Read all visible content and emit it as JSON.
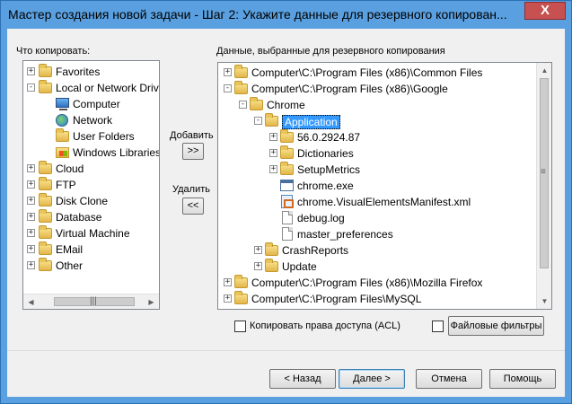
{
  "window": {
    "title": "Мастер создания новой задачи - Шаг 2: Укажите данные для резервного копирован...",
    "close_label": "X"
  },
  "left_panel": {
    "label": "Что копировать:",
    "items": [
      {
        "label": "Favorites",
        "icon": "folder-icon",
        "expander": "+"
      },
      {
        "label": "Local or Network Drive",
        "icon": "folder-icon",
        "expander": "-"
      },
      {
        "label": "Computer",
        "icon": "computer-icon",
        "expander": ""
      },
      {
        "label": "Network",
        "icon": "network-icon",
        "expander": ""
      },
      {
        "label": "User Folders",
        "icon": "folder-icon",
        "expander": ""
      },
      {
        "label": "Windows Libraries",
        "icon": "windows-libraries-icon",
        "expander": ""
      },
      {
        "label": "Cloud",
        "icon": "folder-icon",
        "expander": "+"
      },
      {
        "label": "FTP",
        "icon": "folder-icon",
        "expander": "+"
      },
      {
        "label": "Disk Clone",
        "icon": "folder-icon",
        "expander": "+"
      },
      {
        "label": "Database",
        "icon": "folder-icon",
        "expander": "+"
      },
      {
        "label": "Virtual Machine",
        "icon": "folder-icon",
        "expander": "+"
      },
      {
        "label": "EMail",
        "icon": "folder-icon",
        "expander": "+"
      },
      {
        "label": "Other",
        "icon": "folder-icon",
        "expander": "+"
      }
    ],
    "hscroll_left": "◀",
    "hscroll_right": "▶",
    "hscroll_grip": "|||"
  },
  "middle": {
    "add_label": "Добавить",
    "add_button": ">>",
    "remove_label": "Удалить",
    "remove_button": "<<"
  },
  "right_panel": {
    "label": "Данные, выбранные для резервного копирования",
    "items": [
      {
        "label": "Computer\\C:\\Program Files (x86)\\Common Files",
        "icon": "folder-icon",
        "expander": "+"
      },
      {
        "label": "Computer\\C:\\Program Files (x86)\\Google",
        "icon": "folder-icon",
        "expander": "-"
      },
      {
        "label": "Chrome",
        "icon": "folder-icon",
        "expander": "-"
      },
      {
        "label": "Application",
        "icon": "folder-icon",
        "expander": "-",
        "selected": true
      },
      {
        "label": "56.0.2924.87",
        "icon": "folder-icon",
        "expander": "+"
      },
      {
        "label": "Dictionaries",
        "icon": "folder-icon",
        "expander": "+"
      },
      {
        "label": "SetupMetrics",
        "icon": "folder-icon",
        "expander": "+"
      },
      {
        "label": "chrome.exe",
        "icon": "exe-file-icon",
        "expander": ""
      },
      {
        "label": "chrome.VisualElementsManifest.xml",
        "icon": "xml-file-icon",
        "expander": ""
      },
      {
        "label": "debug.log",
        "icon": "file-icon",
        "expander": ""
      },
      {
        "label": "master_preferences",
        "icon": "file-icon",
        "expander": ""
      },
      {
        "label": "CrashReports",
        "icon": "folder-icon",
        "expander": "+"
      },
      {
        "label": "Update",
        "icon": "folder-icon",
        "expander": "+"
      },
      {
        "label": "Computer\\C:\\Program Files (x86)\\Mozilla Firefox",
        "icon": "folder-icon",
        "expander": "+"
      },
      {
        "label": "Computer\\C:\\Program Files\\MySQL",
        "icon": "folder-icon",
        "expander": "+"
      }
    ],
    "vscroll_up": "▲",
    "vscroll_down": "▼",
    "vscroll_grip": "≡"
  },
  "options": {
    "acl_label": "Копировать права доступа (ACL)",
    "acl_checked": false,
    "filters_checked": false,
    "filters_button": "Файловые фильтры"
  },
  "footer": {
    "back": "< Назад",
    "next": "Далее >",
    "cancel": "Отмена",
    "help": "Помощь"
  }
}
